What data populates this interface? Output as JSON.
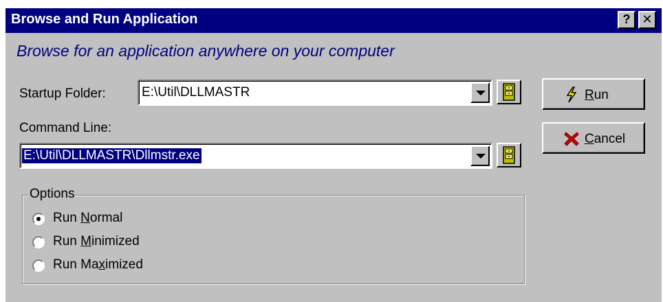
{
  "window": {
    "title": "Browse and Run Application",
    "help_button": "?",
    "close_button": "✕"
  },
  "subtitle": "Browse for an application anywhere on your computer",
  "startup_folder": {
    "label": "Startup Folder:",
    "value": "E:\\Util\\DLLMASTR"
  },
  "command_line": {
    "label": "Command Line:",
    "value": "E:\\Util\\DLLMASTR\\Dllmstr.exe"
  },
  "buttons": {
    "run": {
      "pre": "",
      "u": "R",
      "post": "un",
      "icon": "lightning-icon"
    },
    "cancel": {
      "pre": "",
      "u": "C",
      "post": "ancel",
      "icon": "red-x-icon"
    }
  },
  "options": {
    "legend": "Options",
    "items": [
      {
        "pre": "Run ",
        "u": "N",
        "post": "ormal",
        "selected": true
      },
      {
        "pre": "Run ",
        "u": "M",
        "post": "inimized",
        "selected": false
      },
      {
        "pre": "Run Ma",
        "u": "x",
        "post": "imized",
        "selected": false
      }
    ]
  }
}
